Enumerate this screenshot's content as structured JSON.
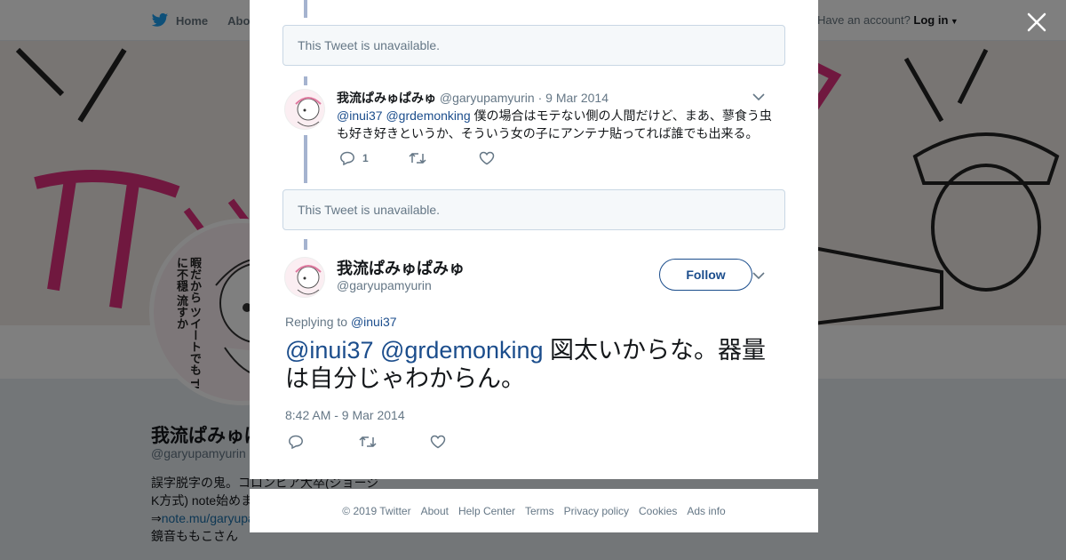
{
  "topbar": {
    "home_label": "Home",
    "about_label": "About",
    "account_prompt": "Have an account?",
    "login_label": "Log in"
  },
  "profile": {
    "name": "我流ぱみゅぱみゅ",
    "handle": "@garyupamyurin",
    "bio_line1": "誤字脱字の鬼。コロンビア大卒(ジョージ",
    "bio_line2": "K方式) note始めました",
    "bio_link": "note.mu/garyupamyurin",
    "bio_line4": "鏡音ももこさん",
    "avatar_caption": "暇だから ツイートでも TLに不穏 流すか"
  },
  "modal": {
    "unavailable_text": "This Tweet is unavailable.",
    "reply_tweet": {
      "name": "我流ぱみゅぱみゅ",
      "handle": "@garyupamyurin",
      "date": "9 Mar 2014",
      "mention1": "@inui37",
      "mention2": "@grdemonking",
      "text": "僕の場合はモテない側の人間だけど、まあ、蓼食う虫も好き好きというか、そういう女の子にアンテナ貼ってれば誰でも出来る。",
      "reply_count": "1"
    },
    "main_tweet": {
      "name": "我流ぱみゅぱみゅ",
      "handle": "@garyupamyurin",
      "follow_label": "Follow",
      "replying_prefix": "Replying to",
      "replying_to": "@inui37",
      "mention1": "@inui37",
      "mention2": "@grdemonking",
      "text": "図太いからな。器量は自分じゃわからん。",
      "timestamp": "8:42 AM - 9 Mar 2014"
    }
  },
  "footer": {
    "copyright": "© 2019 Twitter",
    "links": [
      "About",
      "Help Center",
      "Terms",
      "Privacy policy",
      "Cookies",
      "Ads info"
    ]
  },
  "colors": {
    "link": "#1b4d8c",
    "muted": "#657786",
    "thread": "#a5b3cf",
    "banner_accent": "#e0307f",
    "twitter_blue": "#1da1f2"
  },
  "icons": [
    "twitter-bird-icon",
    "close-icon",
    "reply-icon",
    "retweet-icon",
    "like-icon",
    "chevron-down-icon",
    "caret-down-icon"
  ]
}
